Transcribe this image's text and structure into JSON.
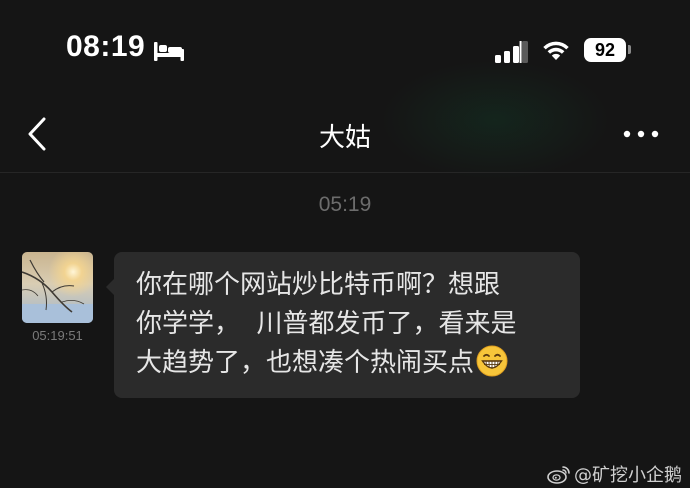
{
  "status_bar": {
    "time": "08:19",
    "battery_level": "92",
    "icons": [
      "bed-icon",
      "signal-icon",
      "wifi-icon",
      "battery-icon"
    ]
  },
  "nav": {
    "back_icon": "chevron-left-icon",
    "title": "大姑",
    "more_icon": "more-horizontal-icon"
  },
  "chat": {
    "section_timestamp": "05:19",
    "messages": [
      {
        "sender_avatar": "avatar-sunset-tree",
        "time": "05:19:51",
        "lines": [
          "你在哪个网站炒比特币啊？想跟",
          "你学学，  川普都发币了，看来是",
          "大趋势了，也想凑个热闹买点"
        ],
        "trailing_emoji": "grinning-face-icon"
      }
    ]
  },
  "watermark": {
    "icon": "weibo-icon",
    "text": "@矿挖小企鹅"
  },
  "colors": {
    "background": "#151515",
    "bubble": "#2b2b2b",
    "timestamp_gray": "#6c6c6c"
  }
}
